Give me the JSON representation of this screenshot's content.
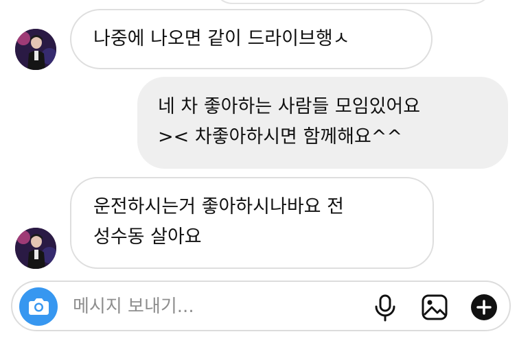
{
  "conversation": {
    "messages": [
      {
        "direction": "incoming",
        "lines": [
          "나중에 나오면 같이 드라이브행ㅅ"
        ]
      },
      {
        "direction": "outgoing",
        "lines": [
          "네 차 좋아하는 사람들 모임있어요",
          "><  차좋아하시면 함께해요^^"
        ]
      },
      {
        "direction": "incoming",
        "lines": [
          "운전하시는거 좋아하시나바요 전",
          "성수동 살아요"
        ]
      }
    ]
  },
  "composer": {
    "placeholder": "메시지 보내기...",
    "value": "",
    "icons": [
      "camera-icon",
      "microphone-icon",
      "gallery-icon",
      "plus-icon"
    ],
    "accent_color": "#3797f0"
  },
  "colors": {
    "incoming_bubble_bg": "#ffffff",
    "incoming_bubble_border": "#dedede",
    "outgoing_bubble_bg": "#efefef",
    "text": "#111111"
  }
}
